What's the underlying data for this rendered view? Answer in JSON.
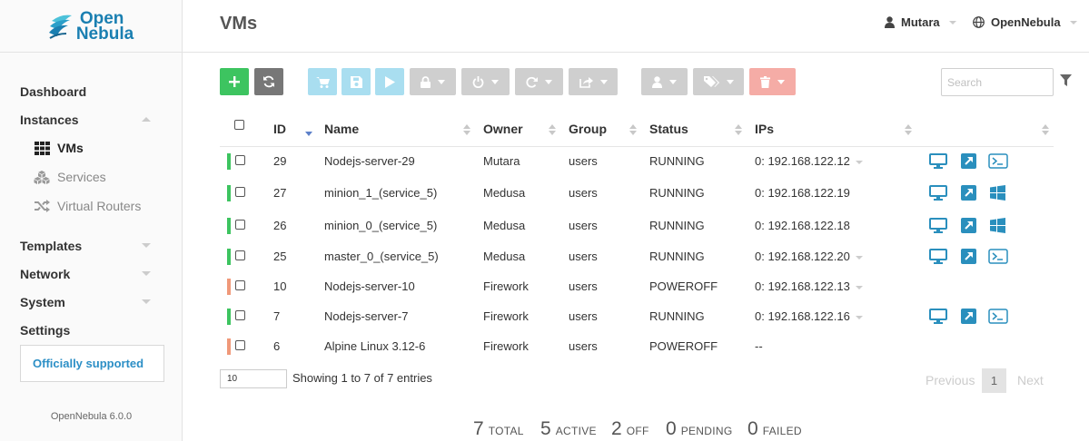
{
  "brand": {
    "line1": "Open",
    "line2": "Nebula"
  },
  "sidebar": {
    "items": [
      {
        "label": "Dashboard"
      },
      {
        "label": "Instances"
      },
      {
        "label": "Templates"
      },
      {
        "label": "Network"
      },
      {
        "label": "System"
      },
      {
        "label": "Settings"
      }
    ],
    "sub_items": [
      {
        "label": "VMs",
        "icon": "grid-icon",
        "active": true
      },
      {
        "label": "Services",
        "icon": "cubes-icon"
      },
      {
        "label": "Virtual Routers",
        "icon": "random-icon"
      }
    ],
    "support_label": "Officially supported",
    "version": "OpenNebula 6.0.0"
  },
  "header": {
    "title": "VMs",
    "user": "Mutara",
    "zone": "OpenNebula"
  },
  "toolbar": {
    "search_placeholder": "Search",
    "colors": {
      "create": "#3dc460",
      "refresh": "#777777",
      "light_blue": "#a9def0",
      "light_gray": "#cfcfcf",
      "light_red": "#f5aca6"
    }
  },
  "table": {
    "columns": [
      "ID",
      "Name",
      "Owner",
      "Group",
      "Status",
      "IPs"
    ],
    "rows": [
      {
        "id": "29",
        "name": "Nodejs-server-29",
        "owner": "Mutara",
        "group": "users",
        "status": "RUNNING",
        "ips": "0: 192.168.122.12",
        "ip_menu": true,
        "state_color": "#3dc460",
        "actions": [
          "vnc-icon",
          "external-link-icon",
          "terminal-icon"
        ]
      },
      {
        "id": "27",
        "name": "minion_1_(service_5)",
        "owner": "Medusa",
        "group": "users",
        "status": "RUNNING",
        "ips": "0: 192.168.122.19",
        "ip_menu": false,
        "state_color": "#3dc460",
        "actions": [
          "vnc-icon",
          "external-link-icon",
          "windows-icon"
        ]
      },
      {
        "id": "26",
        "name": "minion_0_(service_5)",
        "owner": "Medusa",
        "group": "users",
        "status": "RUNNING",
        "ips": "0: 192.168.122.18",
        "ip_menu": false,
        "state_color": "#3dc460",
        "actions": [
          "vnc-icon",
          "external-link-icon",
          "windows-icon"
        ]
      },
      {
        "id": "25",
        "name": "master_0_(service_5)",
        "owner": "Medusa",
        "group": "users",
        "status": "RUNNING",
        "ips": "0: 192.168.122.20",
        "ip_menu": true,
        "state_color": "#3dc460",
        "actions": [
          "vnc-icon",
          "external-link-icon",
          "terminal-icon"
        ]
      },
      {
        "id": "10",
        "name": "Nodejs-server-10",
        "owner": "Firework",
        "group": "users",
        "status": "POWEROFF",
        "ips": "0: 192.168.122.13",
        "ip_menu": true,
        "state_color": "#f0997a",
        "actions": []
      },
      {
        "id": "7",
        "name": "Nodejs-server-7",
        "owner": "Firework",
        "group": "users",
        "status": "RUNNING",
        "ips": "0: 192.168.122.16",
        "ip_menu": true,
        "state_color": "#3dc460",
        "actions": [
          "vnc-icon",
          "external-link-icon",
          "terminal-icon"
        ]
      },
      {
        "id": "6",
        "name": "Alpine Linux 3.12-6",
        "owner": "Firework",
        "group": "users",
        "status": "POWEROFF",
        "ips": "--",
        "ip_menu": false,
        "state_color": "#f0997a",
        "actions": []
      }
    ]
  },
  "footer": {
    "page_length": "10",
    "info": "Showing 1 to 7 of 7 entries",
    "previous": "Previous",
    "current_page": "1",
    "next": "Next"
  },
  "stats": [
    {
      "num": "7",
      "label": "TOTAL"
    },
    {
      "num": "5",
      "label": "ACTIVE"
    },
    {
      "num": "2",
      "label": "OFF"
    },
    {
      "num": "0",
      "label": "PENDING"
    },
    {
      "num": "0",
      "label": "FAILED"
    }
  ]
}
